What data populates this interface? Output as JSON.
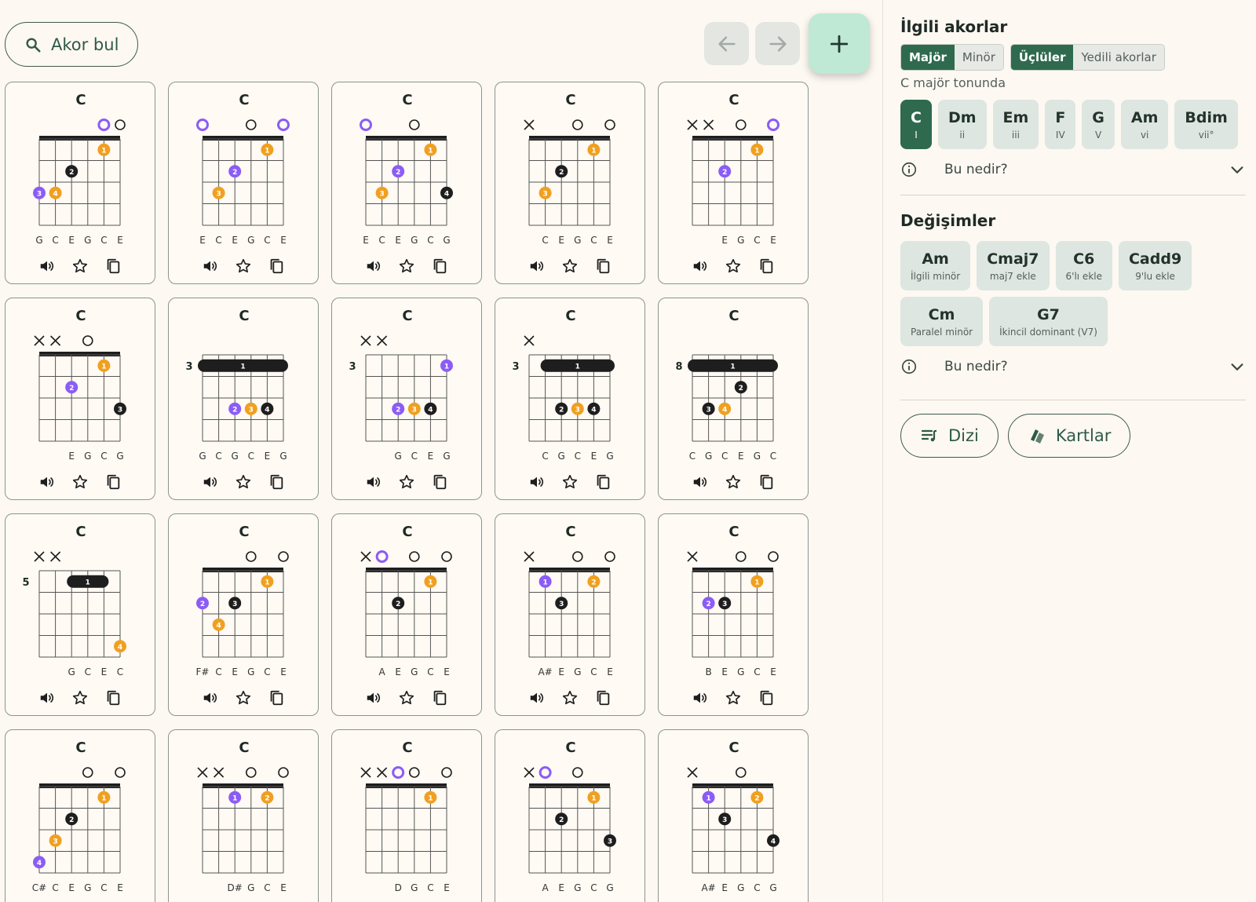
{
  "toolbar": {
    "find_label": "Akor bul"
  },
  "cards": [
    {
      "name": "C",
      "strings": [
        "G",
        "C",
        "E",
        "G",
        "C",
        "E"
      ],
      "markers": [
        "",
        "",
        "",
        "",
        "purple",
        "open"
      ],
      "fret": "",
      "dots": [
        {
          "s": 4,
          "f": 1,
          "l": "1",
          "c": "orange"
        },
        {
          "s": 2,
          "f": 2,
          "l": "2",
          "c": "black"
        },
        {
          "s": 0,
          "f": 3,
          "l": "3",
          "c": "purple"
        },
        {
          "s": 1,
          "f": 3,
          "l": "4",
          "c": "orange"
        }
      ],
      "barre": null
    },
    {
      "name": "C",
      "strings": [
        "E",
        "C",
        "E",
        "G",
        "C",
        "E"
      ],
      "markers": [
        "purple",
        "",
        "",
        "open",
        "",
        "purple"
      ],
      "fret": "",
      "dots": [
        {
          "s": 4,
          "f": 1,
          "l": "1",
          "c": "orange"
        },
        {
          "s": 2,
          "f": 2,
          "l": "2",
          "c": "purple"
        },
        {
          "s": 1,
          "f": 3,
          "l": "3",
          "c": "orange"
        }
      ],
      "barre": null
    },
    {
      "name": "C",
      "strings": [
        "E",
        "C",
        "E",
        "G",
        "C",
        "G"
      ],
      "markers": [
        "purple",
        "",
        "",
        "open",
        "",
        ""
      ],
      "fret": "",
      "dots": [
        {
          "s": 4,
          "f": 1,
          "l": "1",
          "c": "orange"
        },
        {
          "s": 2,
          "f": 2,
          "l": "2",
          "c": "purple"
        },
        {
          "s": 1,
          "f": 3,
          "l": "3",
          "c": "orange"
        },
        {
          "s": 5,
          "f": 3,
          "l": "4",
          "c": "black"
        }
      ],
      "barre": null
    },
    {
      "name": "C",
      "strings": [
        "",
        "C",
        "E",
        "G",
        "C",
        "E"
      ],
      "markers": [
        "x",
        "",
        "",
        "open",
        "",
        "open"
      ],
      "fret": "",
      "dots": [
        {
          "s": 4,
          "f": 1,
          "l": "1",
          "c": "orange"
        },
        {
          "s": 2,
          "f": 2,
          "l": "2",
          "c": "black"
        },
        {
          "s": 1,
          "f": 3,
          "l": "3",
          "c": "orange"
        }
      ],
      "barre": null
    },
    {
      "name": "C",
      "strings": [
        "",
        "",
        "E",
        "G",
        "C",
        "E"
      ],
      "markers": [
        "x",
        "x",
        "",
        "open",
        "",
        "purple"
      ],
      "fret": "",
      "dots": [
        {
          "s": 4,
          "f": 1,
          "l": "1",
          "c": "orange"
        },
        {
          "s": 2,
          "f": 2,
          "l": "2",
          "c": "purple"
        }
      ],
      "barre": null
    },
    {
      "name": "C",
      "strings": [
        "",
        "",
        "E",
        "G",
        "C",
        "G"
      ],
      "markers": [
        "x",
        "x",
        "",
        "open",
        "",
        ""
      ],
      "fret": "",
      "dots": [
        {
          "s": 4,
          "f": 1,
          "l": "1",
          "c": "orange"
        },
        {
          "s": 2,
          "f": 2,
          "l": "2",
          "c": "purple"
        },
        {
          "s": 5,
          "f": 3,
          "l": "3",
          "c": "black"
        }
      ],
      "barre": null
    },
    {
      "name": "C",
      "strings": [
        "G",
        "C",
        "G",
        "C",
        "E",
        "G"
      ],
      "markers": [
        "",
        "",
        "",
        "",
        "",
        ""
      ],
      "fret": "3",
      "dots": [
        {
          "s": 2,
          "f": 3,
          "l": "2",
          "c": "purple"
        },
        {
          "s": 3,
          "f": 3,
          "l": "3",
          "c": "orange"
        },
        {
          "s": 4,
          "f": 3,
          "l": "4",
          "c": "black"
        }
      ],
      "barre": {
        "from": 0,
        "to": 5,
        "f": 1,
        "l": "1"
      }
    },
    {
      "name": "C",
      "strings": [
        "",
        "",
        "G",
        "C",
        "E",
        "G"
      ],
      "markers": [
        "x",
        "x",
        "",
        "",
        "",
        ""
      ],
      "fret": "3",
      "dots": [
        {
          "s": 5,
          "f": 1,
          "l": "1",
          "c": "purple"
        },
        {
          "s": 2,
          "f": 3,
          "l": "2",
          "c": "purple"
        },
        {
          "s": 3,
          "f": 3,
          "l": "3",
          "c": "orange"
        },
        {
          "s": 4,
          "f": 3,
          "l": "4",
          "c": "black"
        }
      ],
      "barre": null
    },
    {
      "name": "C",
      "strings": [
        "",
        "C",
        "G",
        "C",
        "E",
        "G"
      ],
      "markers": [
        "x",
        "",
        "",
        "",
        "",
        ""
      ],
      "fret": "3",
      "dots": [
        {
          "s": 2,
          "f": 3,
          "l": "2",
          "c": "black"
        },
        {
          "s": 3,
          "f": 3,
          "l": "3",
          "c": "orange"
        },
        {
          "s": 4,
          "f": 3,
          "l": "4",
          "c": "black"
        }
      ],
      "barre": {
        "from": 1,
        "to": 5,
        "f": 1,
        "l": "1"
      }
    },
    {
      "name": "C",
      "strings": [
        "C",
        "G",
        "C",
        "E",
        "G",
        "C"
      ],
      "markers": [
        "",
        "",
        "",
        "",
        "",
        ""
      ],
      "fret": "8",
      "dots": [
        {
          "s": 3,
          "f": 2,
          "l": "2",
          "c": "black"
        },
        {
          "s": 1,
          "f": 3,
          "l": "3",
          "c": "black"
        },
        {
          "s": 2,
          "f": 3,
          "l": "4",
          "c": "orange"
        }
      ],
      "barre": {
        "from": 0,
        "to": 5,
        "f": 1,
        "l": "1"
      }
    },
    {
      "name": "C",
      "strings": [
        "",
        "",
        "G",
        "C",
        "E",
        "C"
      ],
      "markers": [
        "x",
        "x",
        "",
        "",
        "",
        ""
      ],
      "fret": "5",
      "dots": [
        {
          "s": 5,
          "f": 4,
          "l": "4",
          "c": "orange"
        }
      ],
      "barre": {
        "from": 2,
        "to": 4,
        "f": 1,
        "l": "1"
      }
    },
    {
      "name": "C",
      "strings": [
        "F#",
        "C",
        "E",
        "G",
        "C",
        "E"
      ],
      "markers": [
        "",
        "",
        "",
        "open",
        "",
        "open"
      ],
      "fret": "",
      "dots": [
        {
          "s": 4,
          "f": 1,
          "l": "1",
          "c": "orange"
        },
        {
          "s": 0,
          "f": 2,
          "l": "2",
          "c": "purple"
        },
        {
          "s": 2,
          "f": 2,
          "l": "3",
          "c": "black"
        },
        {
          "s": 1,
          "f": 3,
          "l": "4",
          "c": "orange"
        }
      ],
      "barre": null
    },
    {
      "name": "C",
      "strings": [
        "A",
        "E",
        "G",
        "C",
        "E"
      ],
      "markers": [
        "x",
        "purple",
        "",
        "open",
        "",
        "open"
      ],
      "fret": "",
      "dots": [
        {
          "s": 4,
          "f": 1,
          "l": "1",
          "c": "orange"
        },
        {
          "s": 2,
          "f": 2,
          "l": "2",
          "c": "black"
        }
      ],
      "barre": null
    },
    {
      "name": "C",
      "strings": [
        "A#",
        "E",
        "G",
        "C",
        "E"
      ],
      "markers": [
        "x",
        "",
        "",
        "open",
        "",
        "open"
      ],
      "fret": "",
      "dots": [
        {
          "s": 1,
          "f": 1,
          "l": "1",
          "c": "purple"
        },
        {
          "s": 4,
          "f": 1,
          "l": "2",
          "c": "orange"
        },
        {
          "s": 2,
          "f": 2,
          "l": "3",
          "c": "black"
        }
      ],
      "barre": null
    },
    {
      "name": "C",
      "strings": [
        "B",
        "E",
        "G",
        "C",
        "E"
      ],
      "markers": [
        "x",
        "",
        "",
        "open",
        "",
        "open"
      ],
      "fret": "",
      "dots": [
        {
          "s": 4,
          "f": 1,
          "l": "1",
          "c": "orange"
        },
        {
          "s": 1,
          "f": 2,
          "l": "2",
          "c": "purple"
        },
        {
          "s": 2,
          "f": 2,
          "l": "3",
          "c": "black"
        }
      ],
      "barre": null
    },
    {
      "name": "C",
      "strings": [
        "C#",
        "C",
        "E",
        "G",
        "C",
        "E"
      ],
      "markers": [
        "",
        "",
        "",
        "open",
        "",
        "open"
      ],
      "fret": "",
      "dots": [
        {
          "s": 4,
          "f": 1,
          "l": "1",
          "c": "orange"
        },
        {
          "s": 2,
          "f": 2,
          "l": "2",
          "c": "black"
        },
        {
          "s": 1,
          "f": 3,
          "l": "3",
          "c": "orange"
        },
        {
          "s": 0,
          "f": 4,
          "l": "4",
          "c": "purple"
        }
      ],
      "barre": null
    },
    {
      "name": "C",
      "strings": [
        "",
        "",
        "D#",
        "G",
        "C",
        "E"
      ],
      "markers": [
        "x",
        "x",
        "",
        "open",
        "",
        "open"
      ],
      "fret": "",
      "dots": [
        {
          "s": 2,
          "f": 1,
          "l": "1",
          "c": "purple"
        },
        {
          "s": 4,
          "f": 1,
          "l": "2",
          "c": "orange"
        }
      ],
      "barre": null
    },
    {
      "name": "C",
      "strings": [
        "",
        "",
        "D",
        "G",
        "C",
        "E"
      ],
      "markers": [
        "x",
        "x",
        "purple",
        "open",
        "",
        "open"
      ],
      "fret": "",
      "dots": [
        {
          "s": 4,
          "f": 1,
          "l": "1",
          "c": "orange"
        }
      ],
      "barre": null
    },
    {
      "name": "C",
      "strings": [
        "",
        "A",
        "E",
        "G",
        "C",
        "G"
      ],
      "markers": [
        "x",
        "purple",
        "",
        "open",
        "",
        ""
      ],
      "fret": "",
      "dots": [
        {
          "s": 4,
          "f": 1,
          "l": "1",
          "c": "orange"
        },
        {
          "s": 2,
          "f": 2,
          "l": "2",
          "c": "black"
        },
        {
          "s": 5,
          "f": 3,
          "l": "3",
          "c": "black"
        }
      ],
      "barre": null
    },
    {
      "name": "C",
      "strings": [
        "",
        "A#",
        "E",
        "G",
        "C",
        "G"
      ],
      "markers": [
        "x",
        "",
        "",
        "open",
        "",
        ""
      ],
      "fret": "",
      "dots": [
        {
          "s": 1,
          "f": 1,
          "l": "1",
          "c": "purple"
        },
        {
          "s": 4,
          "f": 1,
          "l": "2",
          "c": "orange"
        },
        {
          "s": 2,
          "f": 2,
          "l": "3",
          "c": "black"
        },
        {
          "s": 5,
          "f": 3,
          "l": "4",
          "c": "black"
        }
      ],
      "barre": null
    }
  ],
  "colors": {
    "orange": "#f0a020",
    "purple": "#8b5cf6",
    "black": "#1e1e1e",
    "accent": "#2f6a4f"
  },
  "sidebar": {
    "related_title": "İlgili akorlar",
    "mode_tabs": [
      {
        "label": "Majör",
        "active": true
      },
      {
        "label": "Minör",
        "active": false
      }
    ],
    "type_tabs": [
      {
        "label": "Üçlüler",
        "active": true
      },
      {
        "label": "Yedili akorlar",
        "active": false
      }
    ],
    "key_text": "C majör tonunda",
    "degrees": [
      {
        "name": "C",
        "degree": "I",
        "active": true
      },
      {
        "name": "Dm",
        "degree": "ii",
        "active": false
      },
      {
        "name": "Em",
        "degree": "iii",
        "active": false
      },
      {
        "name": "F",
        "degree": "IV",
        "active": false
      },
      {
        "name": "G",
        "degree": "V",
        "active": false
      },
      {
        "name": "Am",
        "degree": "vi",
        "active": false
      },
      {
        "name": "Bdim",
        "degree": "vii°",
        "active": false
      }
    ],
    "whatis_1": "Bu nedir?",
    "changes_title": "Değişimler",
    "changes": [
      {
        "name": "Am",
        "desc": "İlgili minör"
      },
      {
        "name": "Cmaj7",
        "desc": "maj7 ekle"
      },
      {
        "name": "C6",
        "desc": "6'lı ekle"
      },
      {
        "name": "Cadd9",
        "desc": "9'lu ekle"
      },
      {
        "name": "Cm",
        "desc": "Paralel minör"
      },
      {
        "name": "G7",
        "desc": "İkincil dominant (V7)"
      }
    ],
    "whatis_2": "Bu nedir?",
    "scale_button": "Dizi",
    "cards_button": "Kartlar"
  }
}
